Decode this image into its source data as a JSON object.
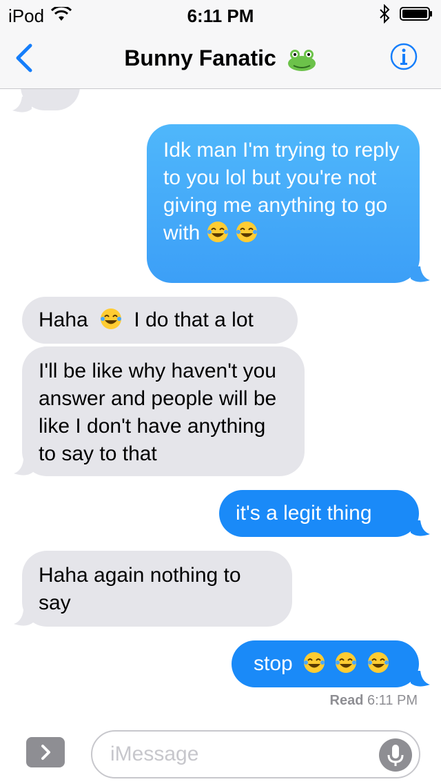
{
  "status_bar": {
    "carrier": "iPod",
    "time": "6:11 PM"
  },
  "nav": {
    "title": "Bunny Fanatic"
  },
  "messages": [
    {
      "text": "Idk man I'm trying to reply to you lol but you're not giving me anything to go with"
    },
    {
      "text_before": "Haha",
      "text_after": "I do that a lot"
    },
    {
      "text": "I'll be like why haven't you answer and people will be like I don't have anything to say to that"
    },
    {
      "text": "it's a legit thing"
    },
    {
      "text": "Haha again nothing to say"
    },
    {
      "text": "stop"
    }
  ],
  "receipt": {
    "label": "Read",
    "time": "6:11 PM"
  },
  "composer": {
    "placeholder": "iMessage"
  },
  "colors": {
    "incoming": "#e5e5ea",
    "outgoing": "#1a8af8",
    "accent": "#157efb"
  },
  "icons": [
    "wifi-icon",
    "bluetooth-icon",
    "battery-icon",
    "back-chevron-icon",
    "frog-emoji-icon",
    "info-icon",
    "tears-of-joy-emoji-icon",
    "app-drawer-chevron-icon",
    "microphone-icon"
  ]
}
